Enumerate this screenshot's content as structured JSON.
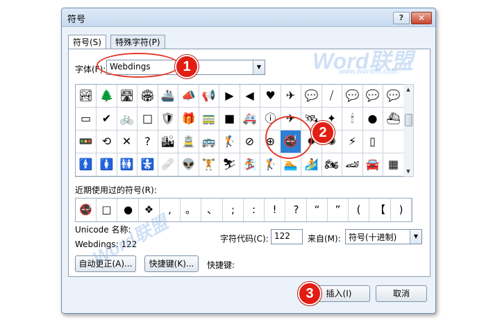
{
  "window": {
    "title": "符号",
    "help_label": "?",
    "close_label": "✕"
  },
  "tabs": [
    {
      "label": "符号(S)",
      "active": true
    },
    {
      "label": "特殊字符(P)",
      "active": false
    }
  ],
  "font": {
    "label": "字体(F):",
    "value": "Webdings",
    "arrow": "▼"
  },
  "symbol_grid": {
    "rows": [
      [
        "🏞",
        "🌲",
        "🛣",
        "🏟",
        "🚢",
        "📣",
        "📢",
        "▶",
        "◀",
        "♥",
        "✈",
        "💬",
        "⧸",
        "💬",
        "💬",
        "💬"
      ],
      [
        "▭",
        "✔",
        "🚲",
        "□",
        "🛡",
        "🎁",
        "🚃",
        "■",
        "🚑",
        "ⓘ",
        "✈",
        "🛰",
        "✦",
        "🕯",
        "●",
        "⛴"
      ],
      [
        "🚥",
        "⟲",
        "✕",
        "?",
        "🏙",
        "🚊",
        "🚌",
        "🏌",
        "⊘",
        "⊕",
        "🚭",
        "✹",
        "✺",
        "⚡",
        "▯",
        ""
      ],
      [
        "🚹",
        "🚺",
        "🚻",
        "🚼",
        "🩹",
        "👽",
        "🏋",
        "⛷",
        "🏂",
        "🏌",
        "🏊",
        "🏄",
        "🏍",
        "🏎",
        "🚘",
        "▦"
      ]
    ],
    "selected": {
      "row": 2,
      "col": 10
    },
    "scroll_up": "▲",
    "scroll_down": "▼"
  },
  "recent": {
    "label": "近期使用过的符号(R):",
    "symbols": [
      "🚭",
      "□",
      "●",
      "❖",
      ",",
      "。",
      "、",
      ";",
      ":",
      "!",
      "?",
      "“",
      "”",
      "(",
      "【",
      ")"
    ]
  },
  "unicode_name": {
    "label": "Unicode 名称:",
    "value": "Webdings: 122"
  },
  "char_code": {
    "label": "字符代码(C):",
    "value": "122"
  },
  "from": {
    "label": "来自(M):",
    "value": "符号(十进制)",
    "arrow": "▼"
  },
  "buttons": {
    "autocorrect": "自动更正(A)...",
    "shortcut_key": "快捷键(K)...",
    "shortcut_label": "快捷键:",
    "insert": "插入(I)",
    "cancel": "取消"
  },
  "annotations": {
    "step1": "1",
    "step2": "2",
    "step3": "3"
  },
  "watermark": {
    "brand": "Word联盟",
    "url": "www.wordlm.com"
  },
  "colors": {
    "callout_red": "#e21d12",
    "selection_blue": "#2f7fd6",
    "watermark_blue": "#78aae6"
  }
}
